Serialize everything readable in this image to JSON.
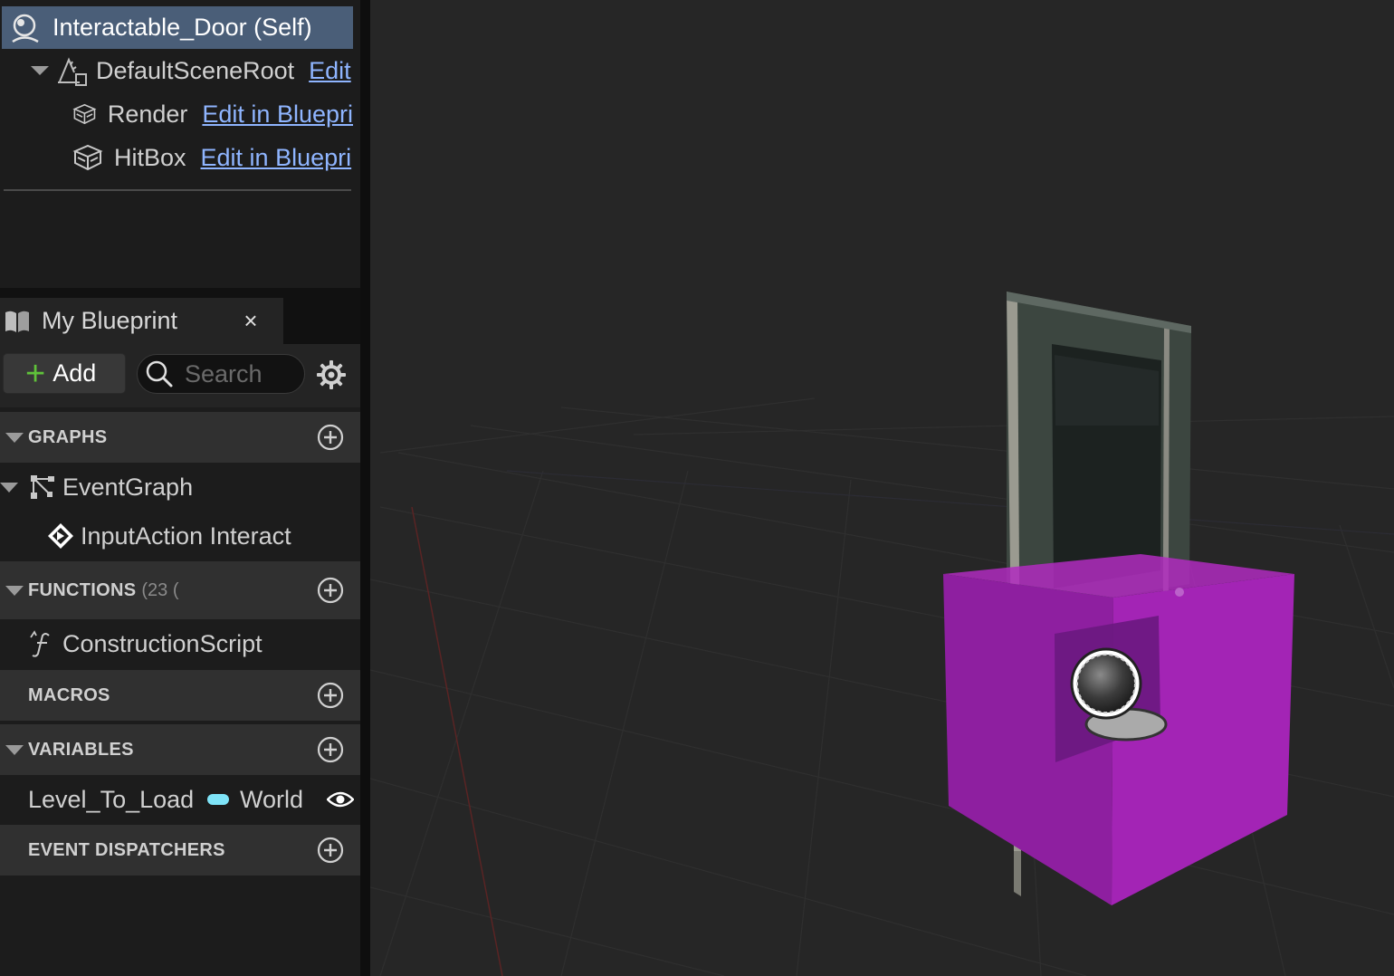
{
  "components": {
    "self_label": "Interactable_Door (Self)",
    "root": {
      "label": "DefaultSceneRoot",
      "link": "Edit"
    },
    "children": [
      {
        "label": "Render",
        "link": "Edit in Bluepri"
      },
      {
        "label": "HitBox",
        "link": "Edit in Bluepri"
      }
    ]
  },
  "tab": {
    "title": "My Blueprint",
    "close": "×"
  },
  "toolbar": {
    "add_label": "Add",
    "search_placeholder": "Search"
  },
  "sections": {
    "graphs": {
      "title": "GRAPHS",
      "items": [
        {
          "label": "EventGraph"
        },
        {
          "label": "InputAction Interact"
        }
      ]
    },
    "functions": {
      "title": "FUNCTIONS",
      "count": "(23 (",
      "items": [
        {
          "label": "ConstructionScript"
        }
      ]
    },
    "macros": {
      "title": "MACROS"
    },
    "variables": {
      "title": "VARIABLES",
      "items": [
        {
          "name": "Level_To_Load",
          "type": "World",
          "type_color": "#7fe4f8"
        }
      ]
    },
    "dispatchers": {
      "title": "EVENT DISPATCHERS"
    }
  },
  "colors": {
    "selection": "#4a5e78",
    "link": "#8fb5ff",
    "add_plus": "#5fc23a",
    "hitbox_magenta": "#a020b0"
  }
}
